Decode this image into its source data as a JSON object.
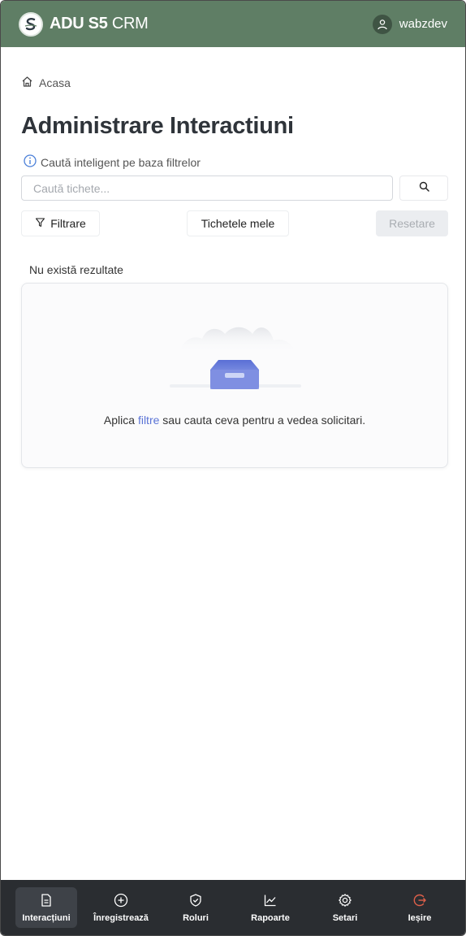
{
  "header": {
    "brand_bold": "ADU S5",
    "brand_light": " CRM",
    "username": "wabzdev"
  },
  "breadcrumb": {
    "home_label": "Acasa"
  },
  "page": {
    "title": "Administrare Interactiuni",
    "hint": "Caută inteligent pe baza filtrelor"
  },
  "search": {
    "placeholder": "Caută tichete...",
    "value": ""
  },
  "toolbar": {
    "filter_label": "Filtrare",
    "mine_label": "Tichetele mele",
    "reset_label": "Resetare"
  },
  "results": {
    "empty_title": "Nu există rezultate",
    "empty_prefix": "Aplica ",
    "empty_link": "filtre",
    "empty_suffix": " sau cauta ceva pentru a vedea solicitari."
  },
  "nav": {
    "items": [
      {
        "label": "Interacțiuni",
        "icon": "document-icon",
        "active": true
      },
      {
        "label": "Înregistrează",
        "icon": "plus-circle-icon"
      },
      {
        "label": "Roluri",
        "icon": "shield-icon"
      },
      {
        "label": "Rapoarte",
        "icon": "chart-line-icon"
      },
      {
        "label": "Setari",
        "icon": "gear-icon"
      },
      {
        "label": "Ieșire",
        "icon": "logout-icon"
      }
    ]
  },
  "colors": {
    "header_bg": "#5f7e65",
    "nav_bg": "#2a2d31",
    "link": "#5b74d6",
    "logout_icon": "#e0604a"
  }
}
